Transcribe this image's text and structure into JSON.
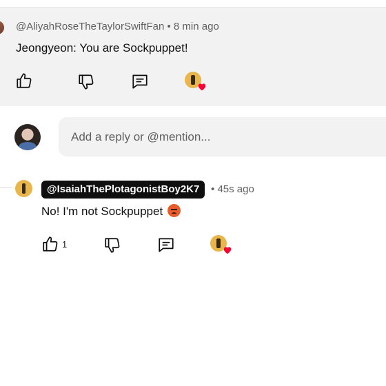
{
  "comment_main": {
    "author": "@AliyahRoseTheTaylorSwiftFan",
    "time": "8 min ago",
    "separator": "•",
    "text": "Jeongyeon: You are Sockpuppet!",
    "actions": {
      "like_icon": "thumb-up-icon",
      "dislike_icon": "thumb-down-icon",
      "reply_icon": "comment-reply-icon",
      "heart_icon": "creator-heart-icon"
    }
  },
  "reply_input": {
    "placeholder": "Add a reply or @mention..."
  },
  "comment_reply": {
    "author": "@IsaiahThePlotagonistBoy2K7",
    "time": "45s ago",
    "separator": "•",
    "text": "No! I'm not Sockpuppet",
    "emoji": "angry-face-icon",
    "like_count": "1"
  },
  "colors": {
    "highlight_bg": "#f2f2f2",
    "secondary_text": "#606060",
    "heart_red": "#ff0033",
    "badge_bg": "#0f0f0f"
  }
}
